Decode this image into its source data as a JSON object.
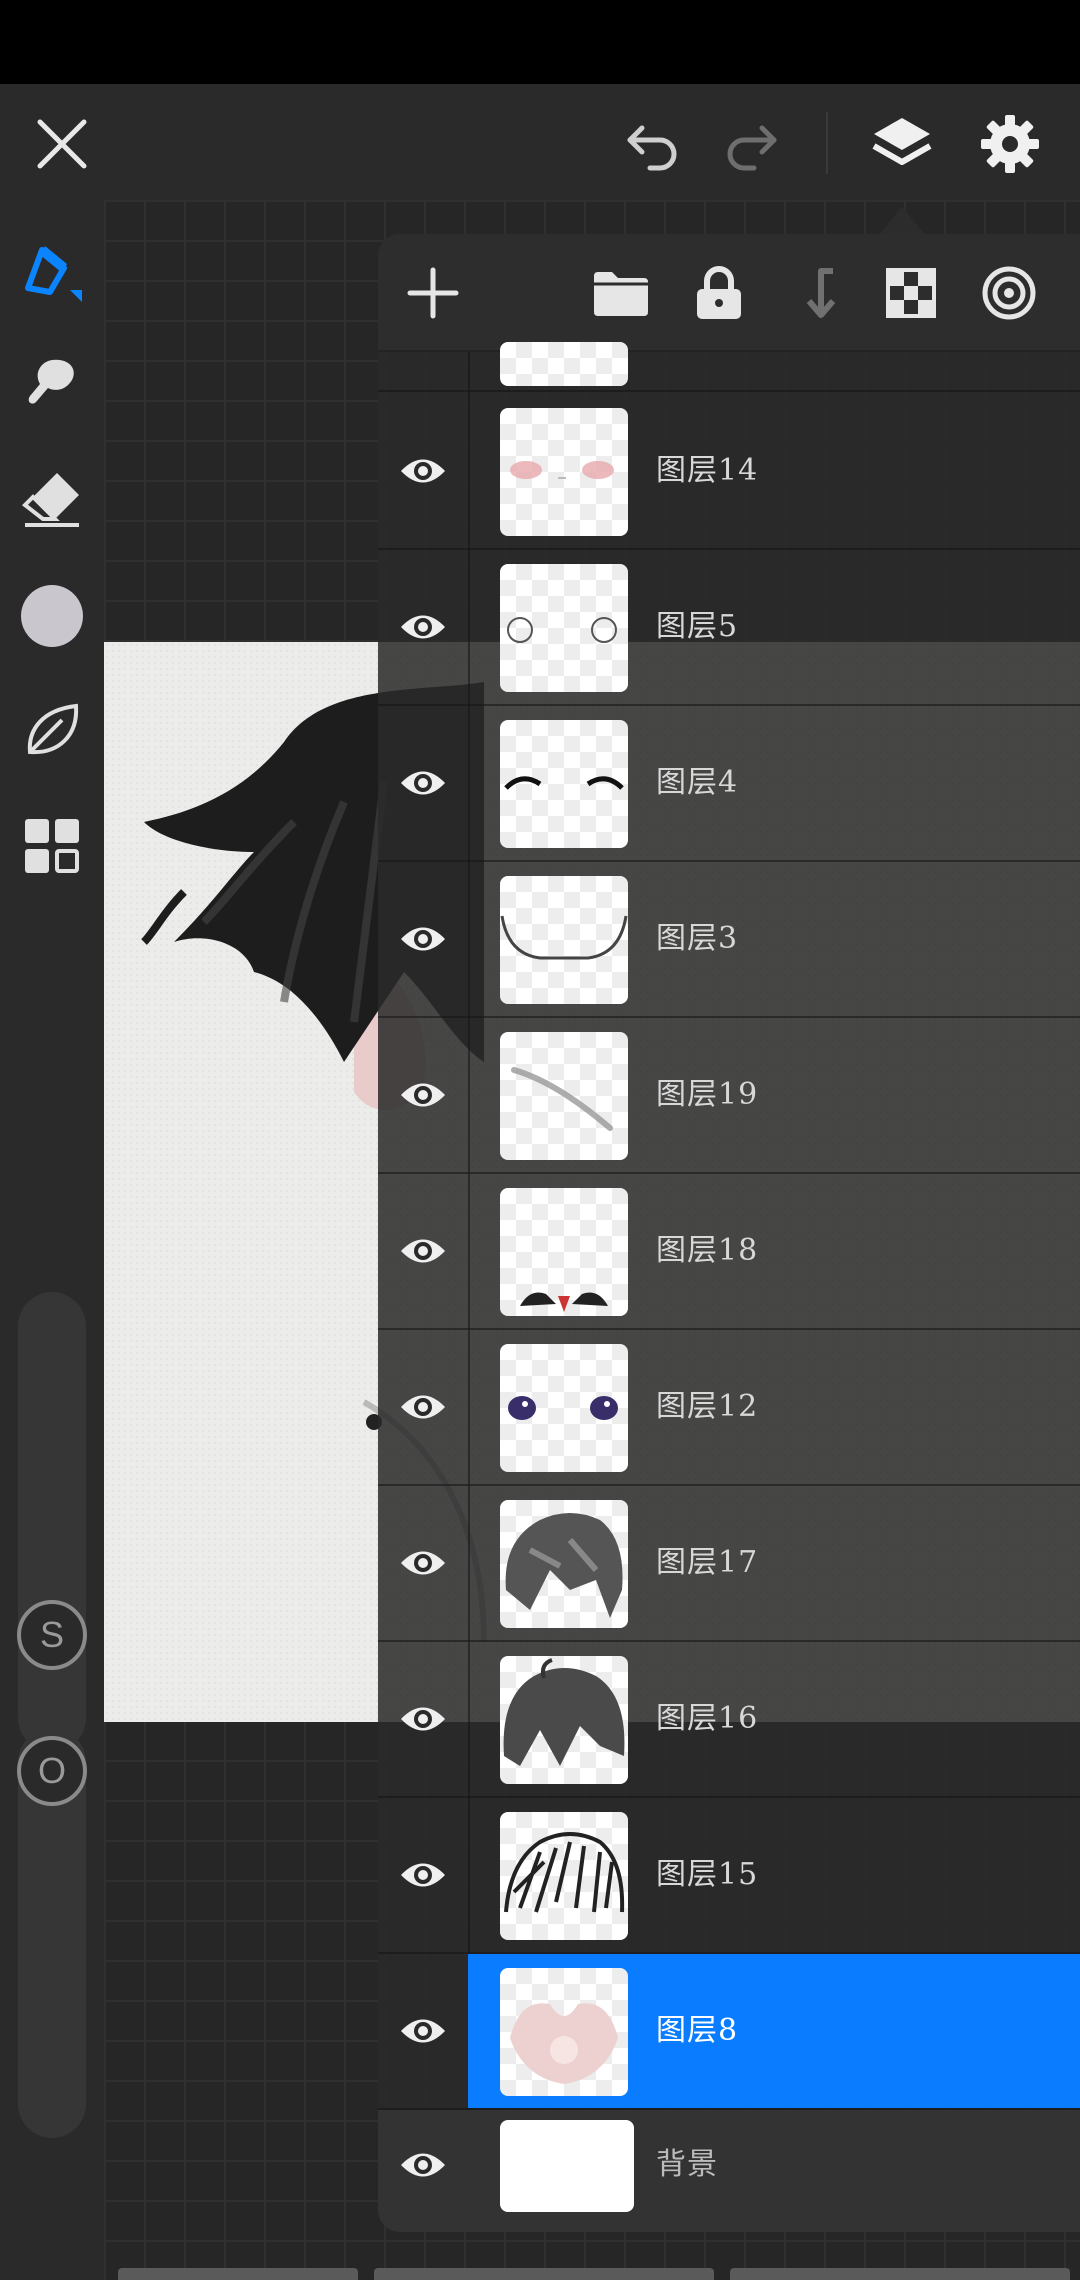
{
  "app": {
    "top_bar": {
      "close_icon": "close-icon",
      "undo_icon": "undo-icon",
      "redo_icon": "redo-icon",
      "layers_icon": "layers-icon",
      "settings_icon": "gear-icon"
    },
    "left_toolbar": {
      "tools": [
        "brush-icon",
        "smudge-icon",
        "eraser-icon",
        "color-swatch",
        "leaf-icon",
        "gallery-icon"
      ],
      "size_button_label": "S",
      "opacity_button_label": "O",
      "active_color": "#c9c6cd",
      "accent_color": "#0a84ff"
    }
  },
  "layers_panel": {
    "header_buttons": [
      "add-icon",
      "folder-icon",
      "lock-icon",
      "merge-down-icon",
      "checker-icon",
      "target-icon"
    ],
    "layers": [
      {
        "name": "图层14"
      },
      {
        "name": "图层5"
      },
      {
        "name": "图层4"
      },
      {
        "name": "图层3"
      },
      {
        "name": "图层19"
      },
      {
        "name": "图层18"
      },
      {
        "name": "图层12"
      },
      {
        "name": "图层17"
      },
      {
        "name": "图层16"
      },
      {
        "name": "图层15"
      },
      {
        "name": "图层8",
        "selected": true
      }
    ],
    "background_layer": {
      "name": "背景"
    },
    "selected_color": "#0a7cff"
  }
}
